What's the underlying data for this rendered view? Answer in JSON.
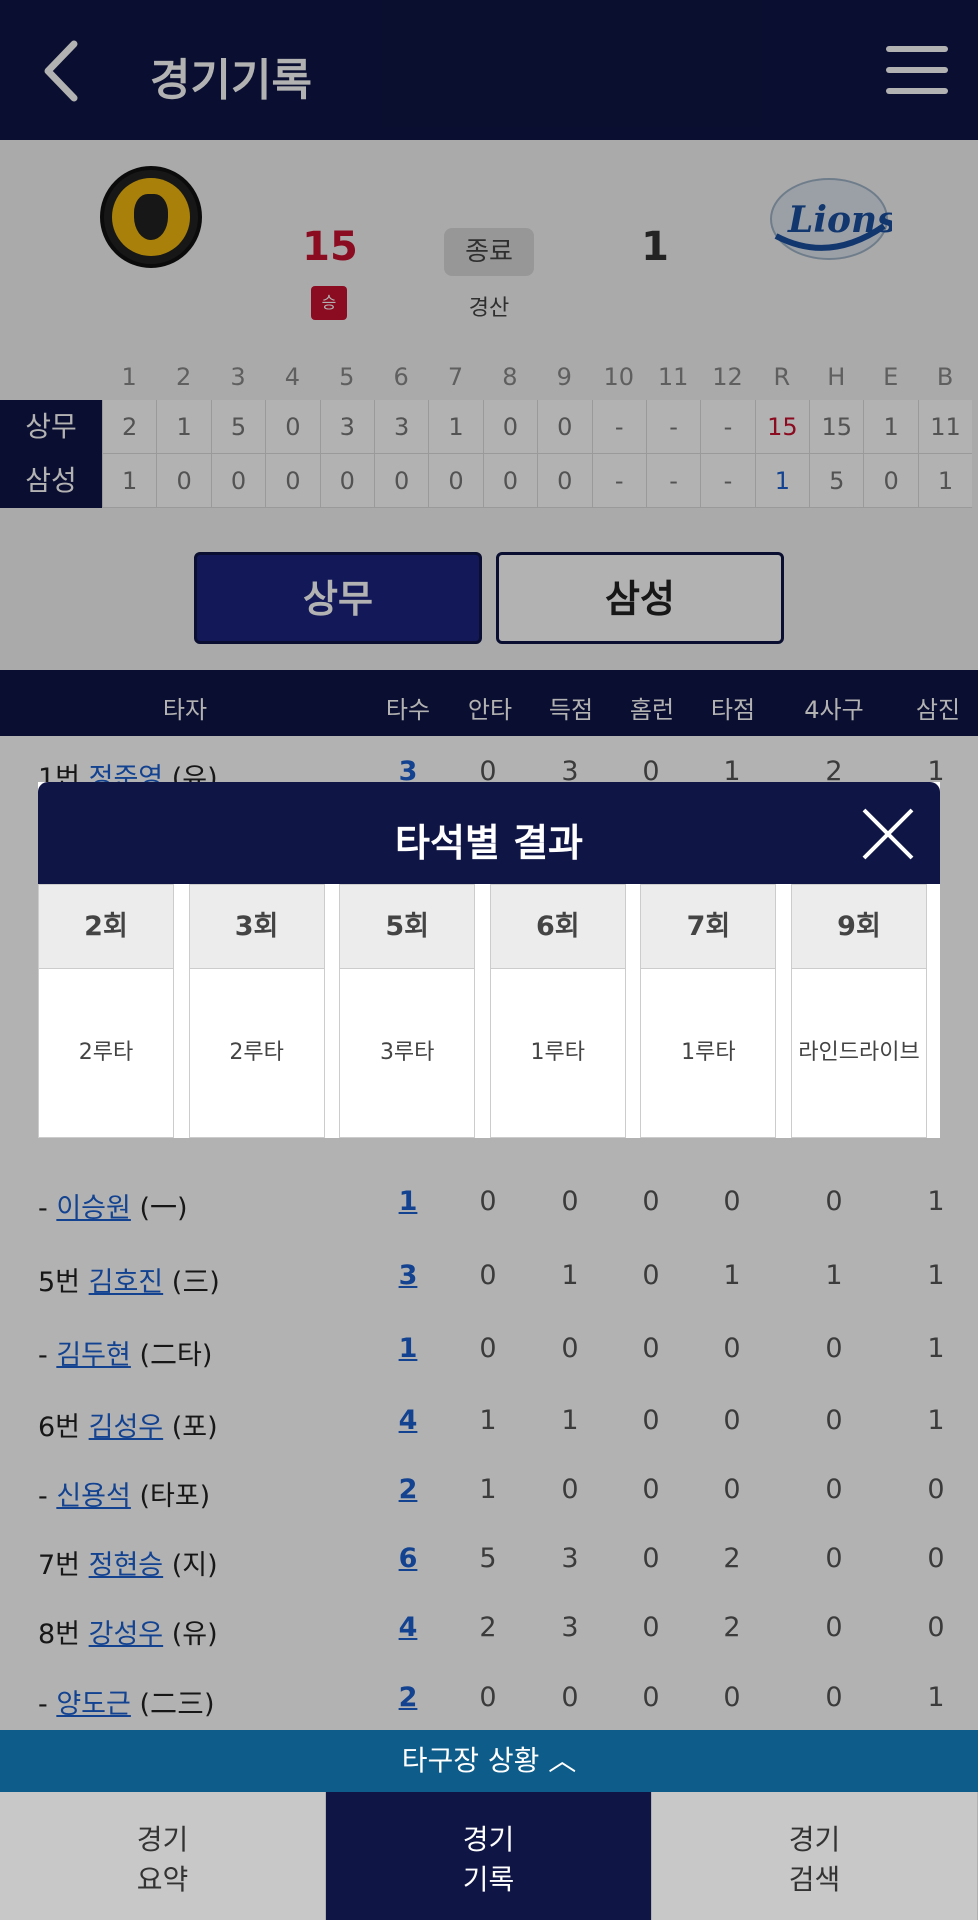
{
  "header": {
    "title": "경기기록"
  },
  "game": {
    "home_score": "15",
    "away_score": "1",
    "win_label": "승",
    "status": "종료",
    "stadium": "경산"
  },
  "innings": {
    "headers": [
      "1",
      "2",
      "3",
      "4",
      "5",
      "6",
      "7",
      "8",
      "9",
      "10",
      "11",
      "12",
      "R",
      "H",
      "E",
      "B"
    ],
    "teams": [
      {
        "name": "상무",
        "values": [
          "2",
          "1",
          "5",
          "0",
          "3",
          "3",
          "1",
          "0",
          "0",
          "-",
          "-",
          "-",
          "15",
          "15",
          "1",
          "11"
        ]
      },
      {
        "name": "삼성",
        "values": [
          "1",
          "0",
          "0",
          "0",
          "0",
          "0",
          "0",
          "0",
          "0",
          "-",
          "-",
          "-",
          "1",
          "5",
          "0",
          "1"
        ]
      }
    ]
  },
  "tabs": {
    "home": "상무",
    "away": "삼성"
  },
  "columns": [
    "타자",
    "타수",
    "안타",
    "득점",
    "홈런",
    "타점",
    "4사구",
    "삼진"
  ],
  "batters": [
    {
      "order": "1번",
      "name": "정준영",
      "pos": "(유)",
      "stats": [
        "3",
        "0",
        "3",
        "0",
        "1",
        "2",
        "1"
      ]
    },
    {
      "order": "-",
      "name": "이승원",
      "pos": "(一)",
      "stats": [
        "1",
        "0",
        "0",
        "0",
        "0",
        "0",
        "1"
      ]
    },
    {
      "order": "5번",
      "name": "김호진",
      "pos": "(三)",
      "stats": [
        "3",
        "0",
        "1",
        "0",
        "1",
        "1",
        "1"
      ]
    },
    {
      "order": "-",
      "name": "김두현",
      "pos": "(二타)",
      "stats": [
        "1",
        "0",
        "0",
        "0",
        "0",
        "0",
        "1"
      ]
    },
    {
      "order": "6번",
      "name": "김성우",
      "pos": "(포)",
      "stats": [
        "4",
        "1",
        "1",
        "0",
        "0",
        "0",
        "1"
      ]
    },
    {
      "order": "-",
      "name": "신용석",
      "pos": "(타포)",
      "stats": [
        "2",
        "1",
        "0",
        "0",
        "0",
        "0",
        "0"
      ]
    },
    {
      "order": "7번",
      "name": "정현승",
      "pos": "(지)",
      "stats": [
        "6",
        "5",
        "3",
        "0",
        "2",
        "0",
        "0"
      ]
    },
    {
      "order": "8번",
      "name": "강성우",
      "pos": "(유)",
      "stats": [
        "4",
        "2",
        "3",
        "0",
        "2",
        "0",
        "0"
      ]
    },
    {
      "order": "-",
      "name": "양도근",
      "pos": "(二三)",
      "stats": [
        "2",
        "0",
        "0",
        "0",
        "0",
        "0",
        "1"
      ]
    }
  ],
  "modal": {
    "title": "타석별 결과",
    "results": [
      {
        "inning": "2회",
        "result": "2루타"
      },
      {
        "inning": "3회",
        "result": "2루타"
      },
      {
        "inning": "5회",
        "result": "3루타"
      },
      {
        "inning": "6회",
        "result": "1루타"
      },
      {
        "inning": "7회",
        "result": "1루타"
      },
      {
        "inning": "9회",
        "result": "라인드라이브"
      }
    ]
  },
  "other_games": "타구장 상황 ︿",
  "bottom_nav": [
    {
      "label": "경기\n요약"
    },
    {
      "label": "경기\n기록"
    },
    {
      "label": "경기\n검색"
    }
  ],
  "colors": {
    "navy": "#0f1545",
    "red": "#c8102e",
    "blue": "#1a5fcf",
    "teal": "#0d5c8a"
  }
}
